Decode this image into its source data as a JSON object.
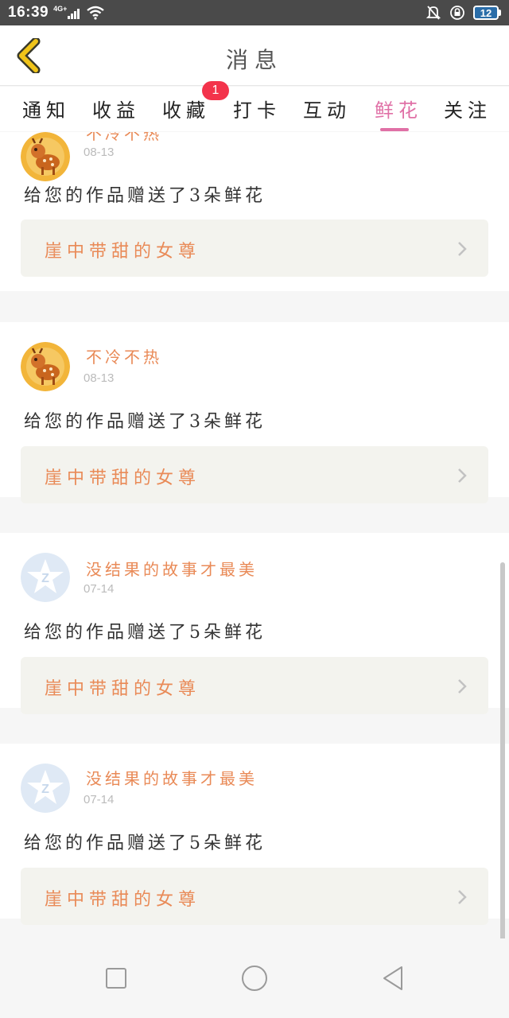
{
  "status_bar": {
    "time": "16:39",
    "network": "4G+",
    "battery": "12",
    "icons": [
      "signal-icon",
      "wifi-icon",
      "mute-icon",
      "rotation-lock-icon",
      "battery-icon"
    ]
  },
  "header": {
    "title": "消息",
    "back_icon": "chevron-left-icon"
  },
  "tabs": [
    {
      "label": "通知"
    },
    {
      "label": "收益"
    },
    {
      "label": "收藏",
      "badge": "1"
    },
    {
      "label": "打卡"
    },
    {
      "label": "互动"
    },
    {
      "label": "鲜花",
      "active": true
    },
    {
      "label": "关注"
    }
  ],
  "notifications": [
    {
      "username": "不冷不热",
      "date": "08-13",
      "message": "给您的作品赠送了3朵鲜花",
      "work_title": "崖中带甜的女尊",
      "avatar": "deer-avatar"
    },
    {
      "username": "不冷不热",
      "date": "08-13",
      "message": "给您的作品赠送了3朵鲜花",
      "work_title": "崖中带甜的女尊",
      "avatar": "deer-avatar"
    },
    {
      "username": "没结果的故事才最美",
      "date": "07-14",
      "message": "给您的作品赠送了5朵鲜花",
      "work_title": "崖中带甜的女尊",
      "avatar": "qq-default-avatar"
    },
    {
      "username": "没结果的故事才最美",
      "date": "07-14",
      "message": "给您的作品赠送了5朵鲜花",
      "work_title": "崖中带甜的女尊",
      "avatar": "qq-default-avatar"
    }
  ],
  "nav_bar": {
    "icons": [
      "recent-apps-icon",
      "home-icon",
      "back-icon"
    ]
  },
  "colors": {
    "accent": "#e070a6",
    "username": "#e98a57",
    "badge": "#f3334b",
    "back_icon": "#f0c419"
  }
}
